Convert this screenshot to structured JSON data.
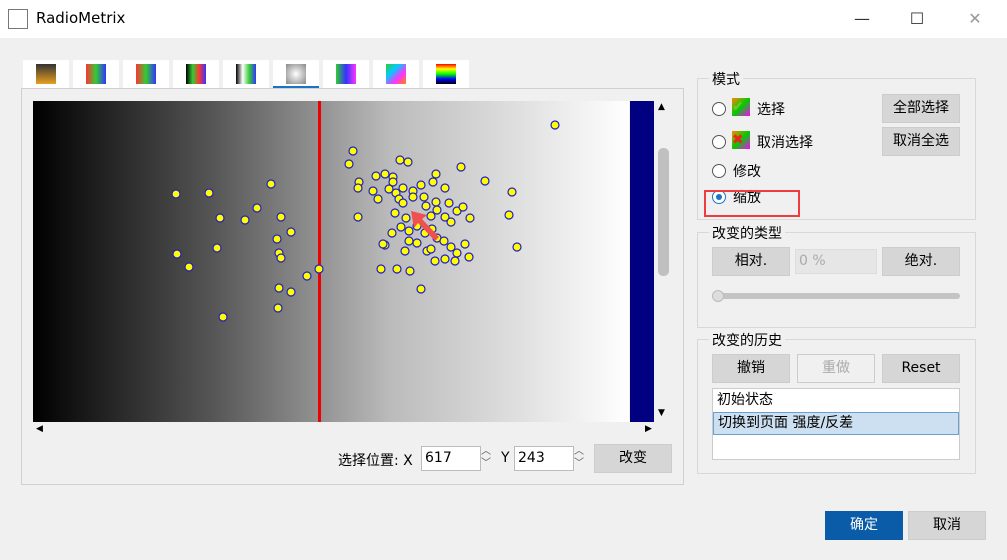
{
  "window": {
    "title": "RadioMetrix",
    "minimize": "—",
    "maximize": "☐",
    "close": "✕"
  },
  "tabs": [
    {
      "icon": "cassette-icon"
    },
    {
      "icon": "rgb-gear-icon"
    },
    {
      "icon": "rgb-hand-icon"
    },
    {
      "icon": "gray-gear-icon"
    },
    {
      "icon": "gray-hand-icon"
    },
    {
      "icon": "texture-icon",
      "active": true
    },
    {
      "icon": "color-bars-icon"
    },
    {
      "icon": "color-square-icon"
    },
    {
      "icon": "spectrum-icon"
    }
  ],
  "position": {
    "label": "选择位置: X",
    "x": "617",
    "y_label": "Y",
    "y": "243",
    "change": "改变"
  },
  "mode": {
    "title": "模式",
    "select": "选择",
    "deselect": "取消选择",
    "modify": "修改",
    "zoom": "缩放",
    "select_all": "全部选择",
    "deselect_all": "取消全选",
    "selected": "zoom"
  },
  "change_type": {
    "title": "改变的类型",
    "relative": "相对.",
    "value": "0 %",
    "absolute": "绝对.",
    "slider": 0
  },
  "history": {
    "title": "改变的历史",
    "undo": "撤销",
    "redo": "重做",
    "reset": "Reset",
    "items": [
      "初始状态",
      "切换到页面 强度/反差"
    ]
  },
  "footer": {
    "ok": "确定",
    "cancel": "取消"
  },
  "colors": {
    "accent": "#1a73c4",
    "marker": "#ffff00",
    "line": "#ee0000",
    "strip": "#000080",
    "highlight": "#f03c3c"
  }
}
